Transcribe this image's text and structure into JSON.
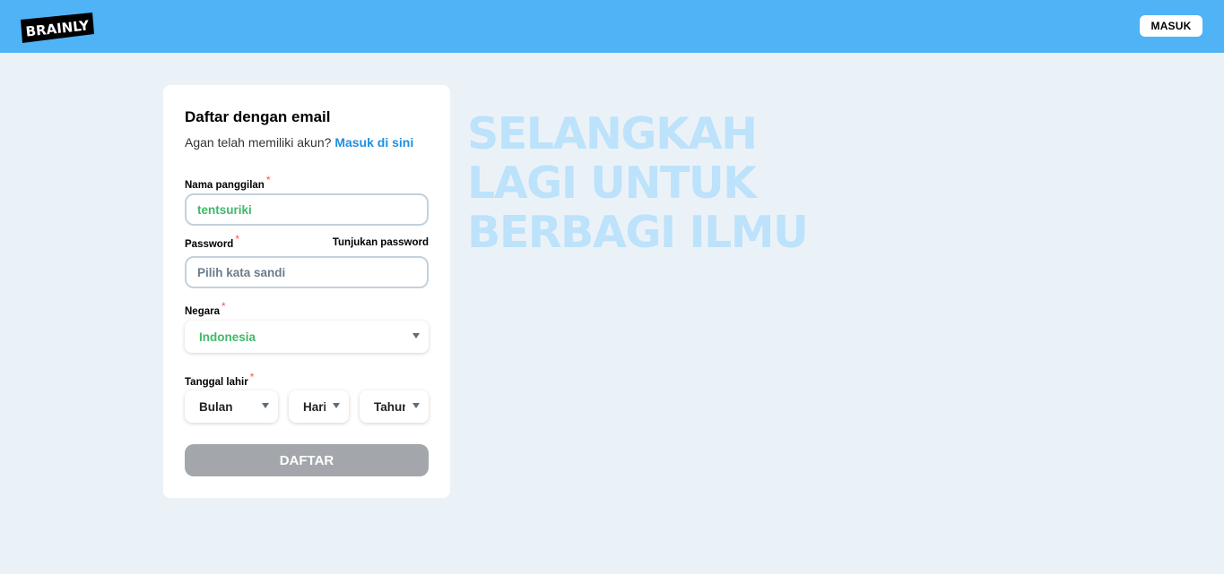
{
  "header": {
    "logo_text": "BRAINLY",
    "login_label": "MASUK"
  },
  "form": {
    "title": "Daftar dengan email",
    "subtitle": "Agan telah memiliki akun?",
    "login_link": "Masuk di sini",
    "required_mark": "*",
    "nickname": {
      "label": "Nama panggilan",
      "value": "tentsuriki"
    },
    "password": {
      "label": "Password",
      "show_label": "Tunjukan password",
      "placeholder": "Pilih kata sandi"
    },
    "country": {
      "label": "Negara",
      "value": "Indonesia"
    },
    "birthdate": {
      "label": "Tanggal lahir",
      "month": "Bulan",
      "day": "Hari",
      "year": "Tahun"
    },
    "submit_label": "DAFTAR"
  },
  "hero": {
    "lines": [
      "SELANGKAH",
      "LAGI UNTUK",
      "BERBAGI ILMU"
    ]
  },
  "colors": {
    "header_bg": "#4fb3f6",
    "page_bg": "#ebf2f7",
    "link": "#1e8fe1",
    "filled_value": "#41b86a",
    "required": "#ff4f4f",
    "disabled_button": "#a3a7ab",
    "hero_text": "#bde2fb"
  }
}
